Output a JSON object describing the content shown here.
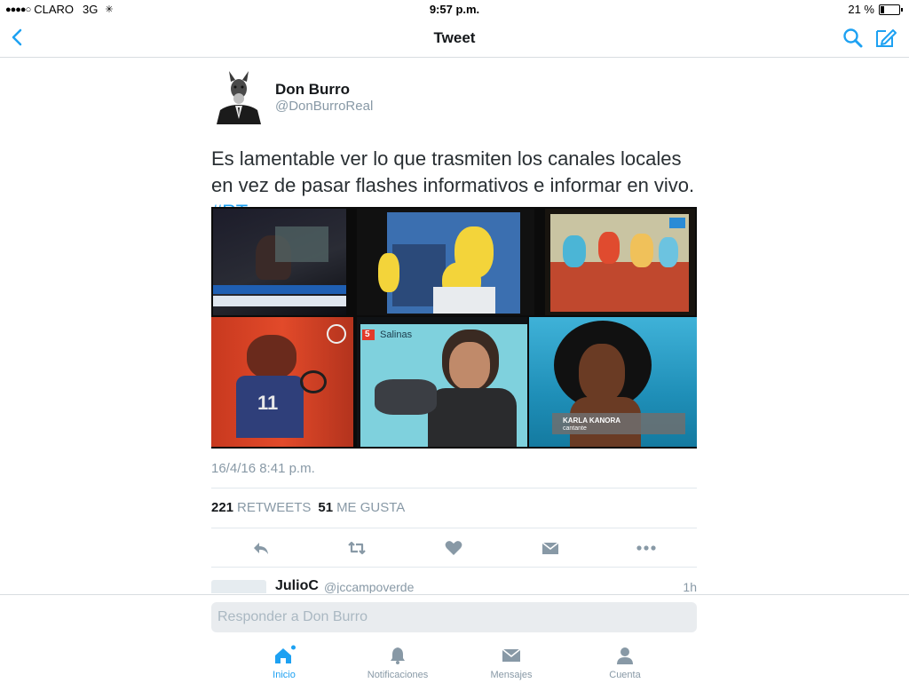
{
  "status": {
    "carrier": "CLARO",
    "network": "3G",
    "time": "9:57 p.m.",
    "battery": "21 %",
    "battery_level": 0.21
  },
  "nav": {
    "title": "Tweet"
  },
  "tweet": {
    "author_name": "Don Burro",
    "author_handle": "@DonBurroReal",
    "text": "Es lamentable ver lo que trasmiten los canales locales en vez de pasar flashes informativos e informar en vivo.",
    "hashtag": "#RT",
    "media_captions": {
      "salinas": "Salinas",
      "karla": "KARLA KANORA",
      "cantante": "cantante",
      "channel": "5"
    },
    "timestamp": "16/4/16 8:41 p.m.",
    "retweets_count": "221",
    "retweets_label": "RETWEETS",
    "likes_count": "51",
    "likes_label": "ME GUSTA"
  },
  "reply_preview": {
    "name": "JulioC",
    "handle": "@jccampoverde",
    "time": "1h"
  },
  "reply_bar": {
    "placeholder": "Responder a Don Burro"
  },
  "tabs": [
    {
      "label": "Inicio",
      "icon": "home-icon"
    },
    {
      "label": "Notificaciones",
      "icon": "bell-icon"
    },
    {
      "label": "Mensajes",
      "icon": "envelope-icon"
    },
    {
      "label": "Cuenta",
      "icon": "person-icon"
    }
  ],
  "colors": {
    "accent": "#1da1f2",
    "muted": "#8899a6"
  }
}
